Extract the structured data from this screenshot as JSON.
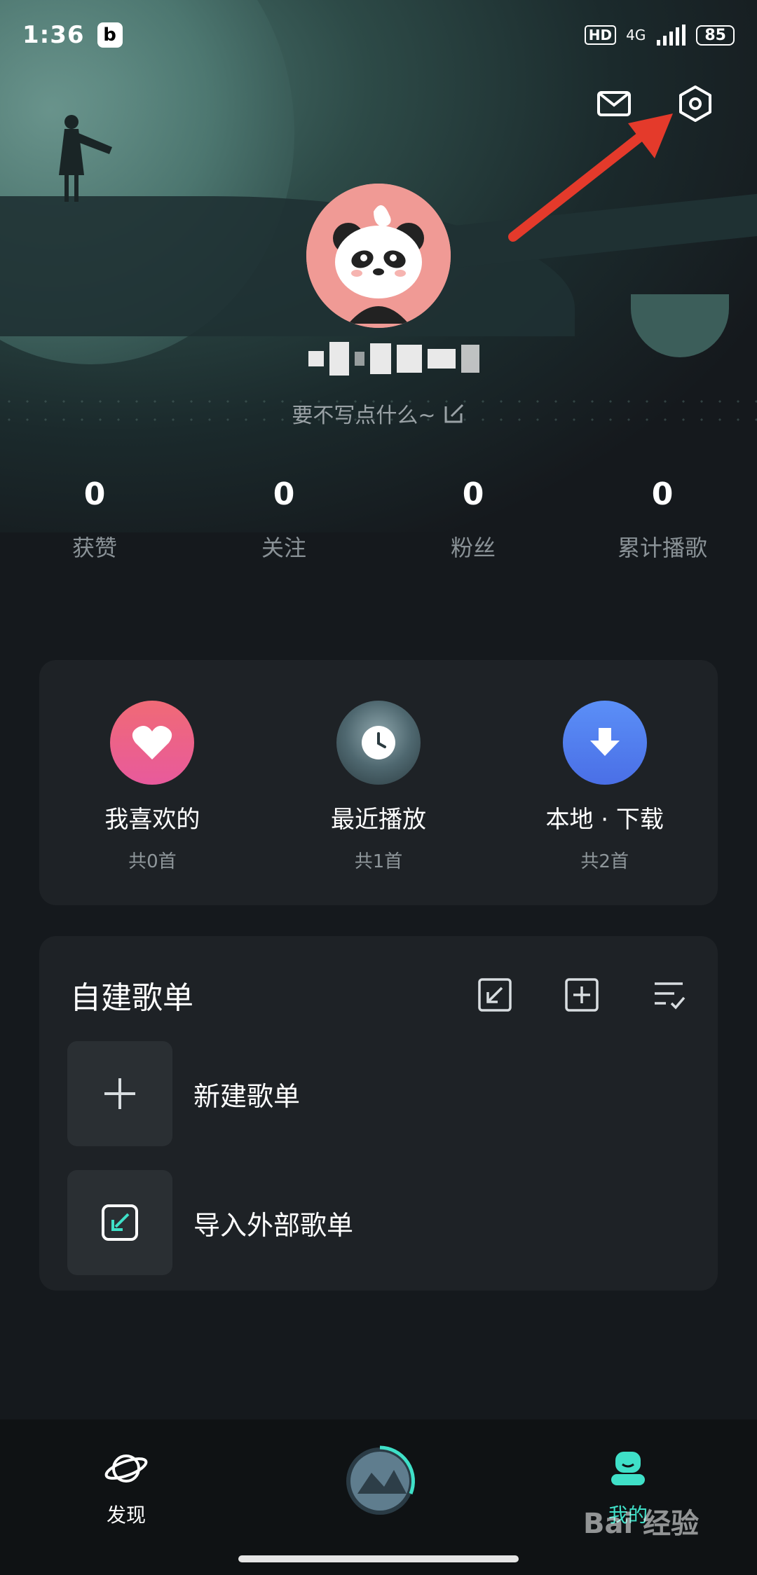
{
  "status_bar": {
    "time": "1:36",
    "app_badge": "b",
    "hd": "HD",
    "network": "4G",
    "battery": "85"
  },
  "profile": {
    "bio": "要不写点什么~"
  },
  "stats": [
    {
      "value": "0",
      "label": "获赞"
    },
    {
      "value": "0",
      "label": "关注"
    },
    {
      "value": "0",
      "label": "粉丝"
    },
    {
      "value": "0",
      "label": "累计播歌"
    }
  ],
  "quick_access": [
    {
      "title": "我喜欢的",
      "count": "共0首",
      "icon": "heart-icon",
      "color": "#ee5f7a"
    },
    {
      "title": "最近播放",
      "count": "共1首",
      "icon": "clock-icon",
      "color": "#3b5560"
    },
    {
      "title": "本地 · 下载",
      "count": "共2首",
      "icon": "download-icon",
      "color": "#4d86f4"
    }
  ],
  "playlist_section": {
    "title": "自建歌单",
    "items": [
      {
        "label": "新建歌单",
        "icon": "plus-icon"
      },
      {
        "label": "导入外部歌单",
        "icon": "import-icon"
      }
    ]
  },
  "bottom_nav": [
    {
      "label": "发现",
      "icon": "planet-icon"
    },
    {
      "label": "",
      "icon": "now-playing-disc"
    },
    {
      "label": "我的",
      "icon": "profile-icon"
    }
  ],
  "watermark": "Bai 经验",
  "colors": {
    "accent": "#3fe0c8",
    "annotation_arrow": "#e43a2b"
  }
}
